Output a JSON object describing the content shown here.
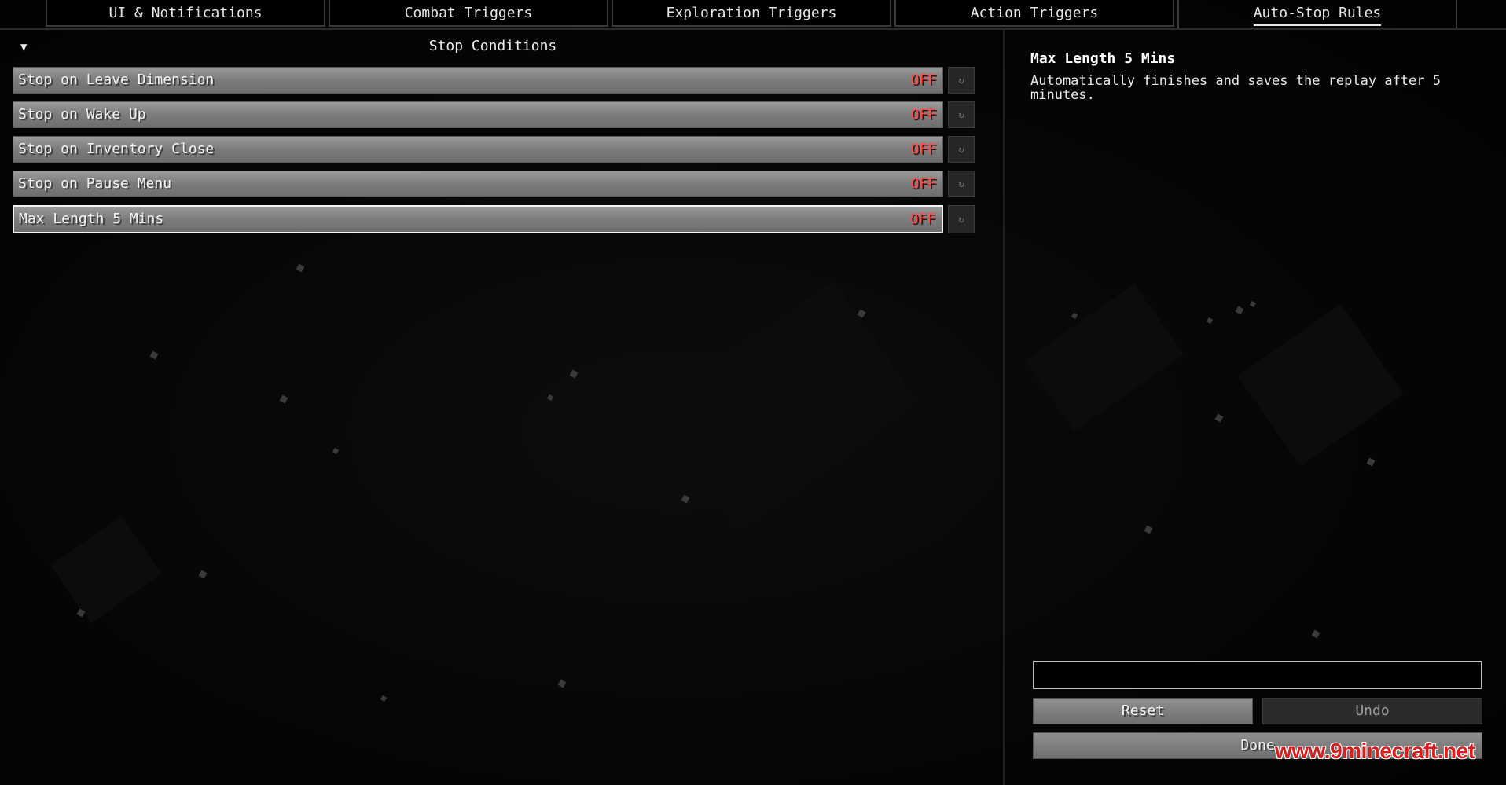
{
  "tabs": [
    {
      "label": "UI & Notifications"
    },
    {
      "label": "Combat Triggers"
    },
    {
      "label": "Exploration Triggers"
    },
    {
      "label": "Action Triggers"
    },
    {
      "label": "Auto-Stop Rules",
      "active": true
    }
  ],
  "section": {
    "toggle_icon": "▼",
    "title": "Stop Conditions"
  },
  "options": [
    {
      "label": "Stop on Leave Dimension",
      "value": "OFF",
      "reset_icon": "↻"
    },
    {
      "label": "Stop on Wake Up",
      "value": "OFF",
      "reset_icon": "↻"
    },
    {
      "label": "Stop on Inventory Close",
      "value": "OFF",
      "reset_icon": "↻"
    },
    {
      "label": "Stop on Pause Menu",
      "value": "OFF",
      "reset_icon": "↻"
    },
    {
      "label": "Max Length 5 Mins",
      "value": "OFF",
      "reset_icon": "↻",
      "selected": true
    }
  ],
  "description": {
    "title": "Max Length 5 Mins",
    "text": "Automatically finishes and saves the replay after 5 minutes."
  },
  "input": {
    "value": ""
  },
  "buttons": {
    "reset": "Reset",
    "undo": "Undo",
    "done": "Done"
  },
  "watermark": "www.9minecraft.net",
  "colors": {
    "off_value": "#ff4a4a",
    "watermark": "#d81e1e"
  }
}
